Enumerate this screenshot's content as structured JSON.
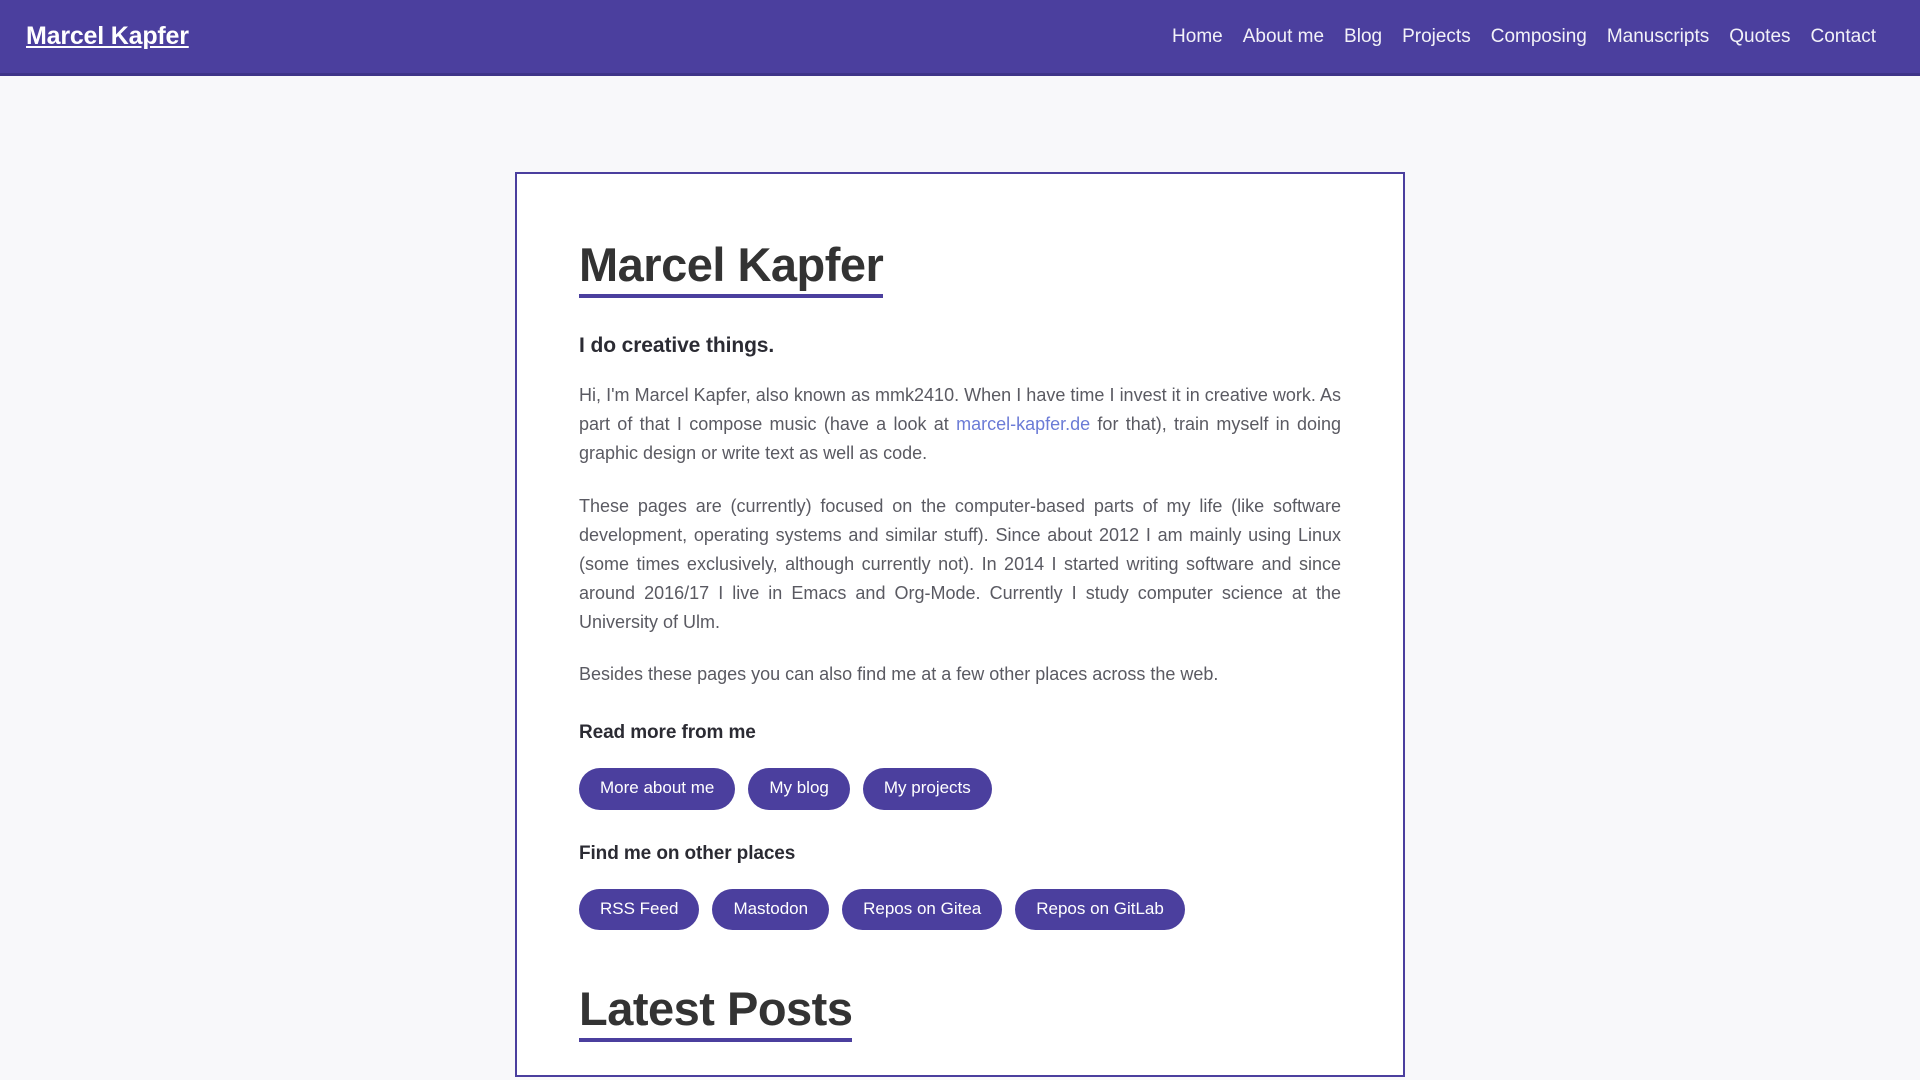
{
  "header": {
    "brand": "Marcel Kapfer",
    "background_color": "#4b3f9e",
    "nav": [
      {
        "label": "Home",
        "name": "nav-home"
      },
      {
        "label": "About me",
        "name": "nav-about-me"
      },
      {
        "label": "Blog",
        "name": "nav-blog"
      },
      {
        "label": "Projects",
        "name": "nav-projects"
      },
      {
        "label": "Composing",
        "name": "nav-composing"
      },
      {
        "label": "Manuscripts",
        "name": "nav-manuscripts"
      },
      {
        "label": "Quotes",
        "name": "nav-quotes"
      },
      {
        "label": "Contact",
        "name": "nav-contact"
      }
    ]
  },
  "main": {
    "title": "Marcel Kapfer",
    "tagline": "I do creative things.",
    "paragraph_1": {
      "before_link": "Hi, I'm Marcel Kapfer, also known as mmk2410. When I have time I invest it in creative work. As part of that I compose music (have a look at ",
      "link_text": "marcel-kapfer.de",
      "after_link": " for that), train myself in doing graphic design or write text as well as code."
    },
    "paragraph_2": "These pages are (currently) focused on the computer-based parts of my life (like software development, operating systems and similar stuff). Since about 2012 I am mainly using Linux (some times exclusively, although currently not). In 2014 I started writing software and since around 2016/17 I live in Emacs and Org-Mode. Currently I study computer science at the University of Ulm.",
    "paragraph_3": "Besides these pages you can also find me at a few other places across the web.",
    "read_more_heading": "Read more from me",
    "read_more_buttons": [
      {
        "label": "More about me",
        "name": "button-more-about-me"
      },
      {
        "label": "My blog",
        "name": "button-my-blog"
      },
      {
        "label": "My projects",
        "name": "button-my-projects"
      }
    ],
    "other_places_heading": "Find me on other places",
    "other_places_buttons": [
      {
        "label": "RSS Feed",
        "name": "button-rss-feed"
      },
      {
        "label": "Mastodon",
        "name": "button-mastodon"
      },
      {
        "label": "Repos on Gitea",
        "name": "button-repos-on-gitea"
      },
      {
        "label": "Repos on GitLab",
        "name": "button-repos-on-gitlab"
      }
    ],
    "latest_posts_heading": "Latest Posts"
  },
  "theme": {
    "accent": "#4b3f9e",
    "accent_dark": "#3e3488",
    "page_background": "#f8f8fa",
    "card_background": "#ffffff",
    "heading_color": "#333333",
    "body_text_color": "#5a5a62",
    "link_color": "#6b7bd6"
  }
}
